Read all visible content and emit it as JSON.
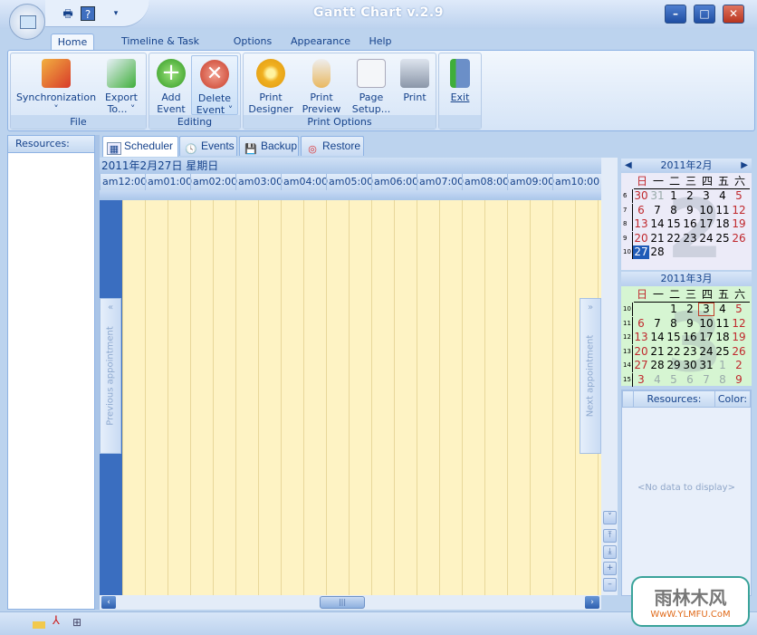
{
  "app": {
    "title": "Gantt Chart v.2.9"
  },
  "qat": {
    "icons": [
      "print-icon",
      "help-icon",
      "customize-icon"
    ]
  },
  "window_buttons": [
    "minimize",
    "maximize",
    "close"
  ],
  "ribbon_tabs": [
    "Home",
    "Timeline & Task Options",
    "Options",
    "Appearance",
    "Help"
  ],
  "active_tab": "Home",
  "groups": {
    "file": {
      "label": "File",
      "sync": "Synchronization",
      "export1": "Export",
      "export2": "To... ˅"
    },
    "editing": {
      "label": "Editing",
      "add1": "Add",
      "add2": "Event",
      "del1": "Delete",
      "del2": "Event ˅"
    },
    "print": {
      "label": "Print Options",
      "pd1": "Print",
      "pd2": "Designer",
      "pp1": "Print",
      "pp2": "Preview",
      "ps1": "Page",
      "ps2": "Setup...",
      "pr": "Print"
    },
    "exit": {
      "label": "Exit"
    }
  },
  "left_panel": {
    "header": "Resources:"
  },
  "view_tabs": [
    "Scheduler",
    "Events",
    "Backup",
    "Restore"
  ],
  "active_view": "Scheduler",
  "scheduler": {
    "date": "2011年2月27日 星期日",
    "hours": [
      "am12:00",
      "am01:00",
      "am02:00",
      "am03:00",
      "am04:00",
      "am05:00",
      "am06:00",
      "am07:00",
      "am08:00",
      "am09:00",
      "am10:00"
    ],
    "prev": "Previous appointment",
    "next": "Next appointment"
  },
  "calendars": [
    {
      "title": "2011年2月",
      "big": "2",
      "dow": [
        "日",
        "一",
        "二",
        "三",
        "四",
        "五",
        "六"
      ],
      "weeks": [
        [
          "6",
          "30",
          "31",
          "1",
          "2",
          "3",
          "4",
          "5"
        ],
        [
          "7",
          "6",
          "7",
          "8",
          "9",
          "10",
          "11",
          "12"
        ],
        [
          "8",
          "13",
          "14",
          "15",
          "16",
          "17",
          "18",
          "19"
        ],
        [
          "9",
          "20",
          "21",
          "22",
          "23",
          "24",
          "25",
          "26"
        ],
        [
          "10",
          "27",
          "28",
          "",
          "",
          "",
          "",
          ""
        ]
      ],
      "other": [
        "30",
        "31"
      ],
      "selected": "27"
    },
    {
      "title": "2011年3月",
      "big": "3",
      "dow": [
        "日",
        "一",
        "二",
        "三",
        "四",
        "五",
        "六"
      ],
      "weeks": [
        [
          "10",
          "",
          "",
          "1",
          "2",
          "3",
          "4",
          "5"
        ],
        [
          "11",
          "6",
          "7",
          "8",
          "9",
          "10",
          "11",
          "12"
        ],
        [
          "12",
          "13",
          "14",
          "15",
          "16",
          "17",
          "18",
          "19"
        ],
        [
          "13",
          "20",
          "21",
          "22",
          "23",
          "24",
          "25",
          "26"
        ],
        [
          "14",
          "27",
          "28",
          "29",
          "30",
          "31",
          "1",
          "2"
        ],
        [
          "15",
          "3",
          "4",
          "5",
          "6",
          "7",
          "8",
          "9"
        ]
      ],
      "today": "3"
    }
  ],
  "resources_grid": {
    "col1": "Resources:",
    "col2": "Color:",
    "empty": "<No data to display>"
  },
  "watermark": {
    "text1": "雨林木风",
    "text2": "WwW.YLMFU.CoM"
  },
  "colors": {
    "accent": "#15428b",
    "grid": "#fef3c4",
    "selected": "#1f5bb8",
    "weekend": "#c0282d"
  }
}
